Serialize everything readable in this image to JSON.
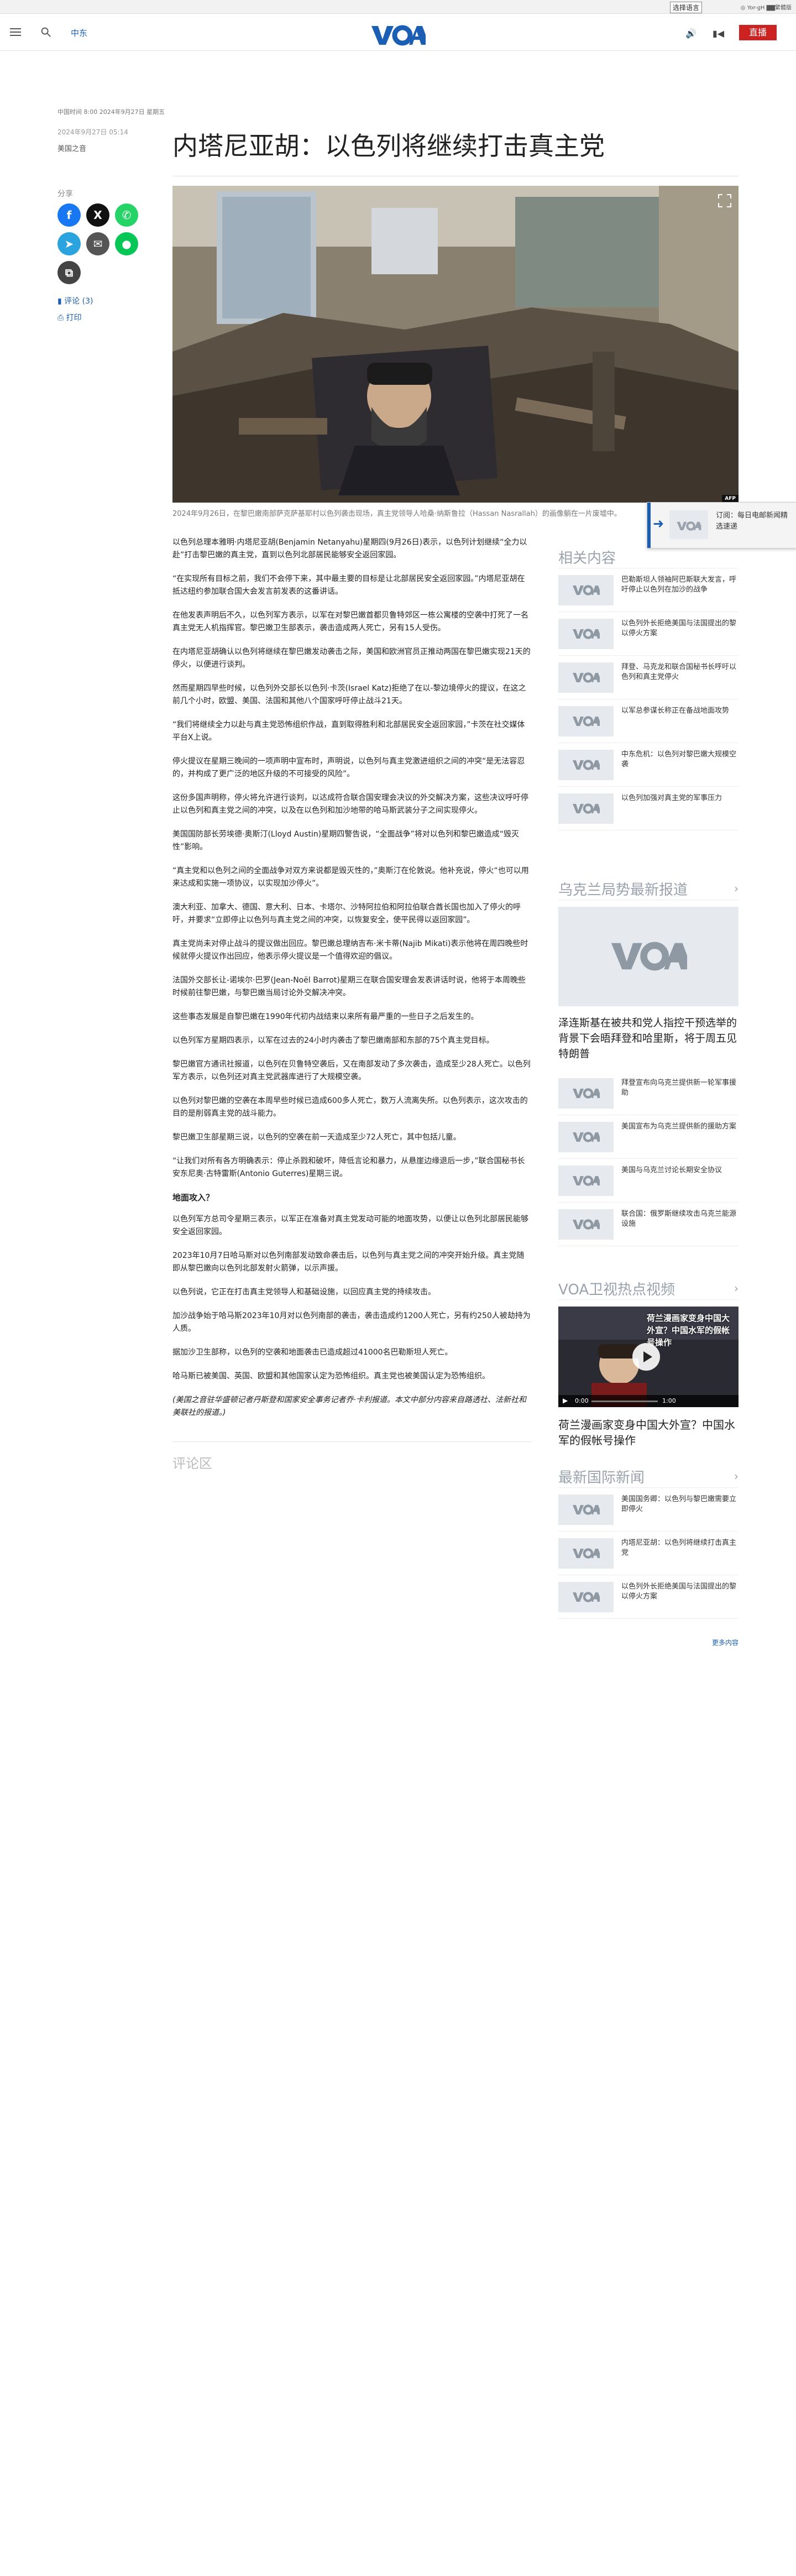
{
  "topbar": {
    "language_select": "选择语言",
    "small_links": "◎ Yor-gH ▇▇繁體版"
  },
  "header": {
    "section": "中东",
    "live_label": "直播",
    "logo_text": "VOA"
  },
  "article": {
    "dateline": "中国时间 8:00 2024年9月27日 星期五",
    "published": "2024年9月27日 05:14",
    "author": "美国之音",
    "title": "内塔尼亚胡：以色列将继续打击真主党",
    "share_label": "分享",
    "comments_link": "评论 (3)",
    "print_link": "打印",
    "photo_caption": "2024年9月26日，在黎巴嫩南部萨克萨基耶村以色列袭击现场，真主党领导人哈桑·纳斯鲁拉（Hassan Nasrallah）的画像躺在一片废墟中。",
    "photo_credit": "AFP",
    "paragraphs": [
      "以色列总理本雅明·内塔尼亚胡(Benjamin Netanyahu)星期四(9月26日)表示，以色列计划继续“全力以赴”打击黎巴嫩的真主党，直到以色列北部居民能够安全返回家园。",
      "“在实现所有目标之前，我们不会停下来，其中最主要的目标是让北部居民安全返回家园。”内塔尼亚胡在抵达纽约参加联合国大会发言前发表的这番讲话。",
      "在他发表声明后不久，以色列军方表示，以军在对黎巴嫩首都贝鲁特郊区一栋公寓楼的空袭中打死了一名真主党无人机指挥官。黎巴嫩卫生部表示，袭击造成两人死亡，另有15人受伤。",
      "在内塔尼亚胡确认以色列将继续在黎巴嫩发动袭击之际，美国和欧洲官员正推动两国在黎巴嫩实现21天的停火，以便进行谈判。",
      "然而星期四早些时候，以色列外交部长以色列·卡茨(Israel Katz)拒绝了在以-黎边境停火的提议，在这之前几个小时，欧盟、美国、法国和其他八个国家呼吁停止战斗21天。",
      "“我们将继续全力以赴与真主党恐怖组织作战，直到取得胜利和北部居民安全返回家园，”卡茨在社交媒体平台X上说。",
      "停火提议在星期三晚间的一项声明中宣布时，声明说，以色列与真主党激进组织之间的冲突“是无法容忍的，并构成了更广泛的地区升级的不可接受的风险”。",
      "这份多国声明称，停火将允许进行谈判，以达成符合联合国安理会决议的外交解决方案，这些决议呼吁停止以色列和真主党之间的冲突，以及在以色列和加沙地带的哈马斯武装分子之间实现停火。",
      "美国国防部长劳埃德·奥斯汀(Lloyd Austin)星期四警告说，“全面战争”将对以色列和黎巴嫩造成“毁灭性”影响。",
      "“真主党和以色列之间的全面战争对双方来说都是毁灭性的，”奥斯汀在伦敦说。他补充说，停火“也可以用来达成和实施一项协议，以实现加沙停火”。",
      "澳大利亚、加拿大、德国、意大利、日本、卡塔尔、沙特阿拉伯和阿拉伯联合酋长国也加入了停火的呼吁，并要求“立即停止以色列与真主党之间的冲突，以恢复安全，使平民得以返回家园”。",
      "真主党尚未对停止战斗的提议做出回应。黎巴嫩总理纳吉布·米卡蒂(Najib Mikati)表示他将在周四晚些时候就停火提议作出回应，他表示停火提议是一个值得欢迎的倡议。",
      "法国外交部长让-诺埃尔·巴罗(Jean-Noël Barrot)星期三在联合国安理会发表讲话时说，他将于本周晚些时候前往黎巴嫩，与黎巴嫩当局讨论外交解决冲突。",
      "这些事态发展是自黎巴嫩在1990年代初内战结束以来所有最严重的一些日子之后发生的。",
      "以色列军方星期四表示，以军在过去的24小时内袭击了黎巴嫩南部和东部的75个真主党目标。",
      "黎巴嫩官方通讯社报道，以色列在贝鲁特空袭后，又在南部发动了多次袭击，造成至少28人死亡。以色列军方表示，以色列还对真主党武器库进行了大规模空袭。",
      "以色列对黎巴嫩的空袭在本周早些时候已造成600多人死亡，数万人流离失所。以色列表示，这次攻击的目的是削弱真主党的战斗能力。",
      "黎巴嫩卫生部星期三说，以色列的空袭在前一天造成至少72人死亡，其中包括儿童。",
      "“让我们对所有各方明确表示：停止杀戮和破坏，降低言论和暴力，从悬崖边缘退后一步，”联合国秘书长安东尼奥·古特雷斯(Antonio Guterres)星期三说。"
    ],
    "subheading": "地面攻入？",
    "paragraphs2": [
      "以色列军方总司令星期三表示，以军正在准备对真主党发动可能的地面攻势，以便让以色列北部居民能够安全返回家园。",
      "2023年10月7日哈马斯对以色列南部发动致命袭击后，以色列与真主党之间的冲突开始升级。真主党随即从黎巴嫩向以色列北部发射火箭弹，以示声援。",
      "以色列说，它正在打击真主党领导人和基础设施，以回应真主党的持续攻击。",
      "加沙战争始于哈马斯2023年10月对以色列南部的袭击，袭击造成约1200人死亡，另有约250人被劫持为人质。",
      "据加沙卫生部称，以色列的空袭和地面袭击已造成超过41000名巴勒斯坦人死亡。",
      "哈马斯已被美国、英国、欧盟和其他国家认定为恐怖组织。真主党也被美国认定为恐怖组织。"
    ],
    "credit": "(美国之音驻华盛顿记者丹斯登和国家安全事务记者乔·卡利报道。本文中部分内容来自路透社、法新社和美联社的报道。)"
  },
  "float_widget": {
    "text": "订阅：每日电邮新闻精选速递"
  },
  "comments": {
    "title": "评论区"
  },
  "sidebar": {
    "related_title": "相关内容",
    "related": [
      "巴勒斯坦人领袖阿巴斯联大发言，呼吁停止以色列在加沙的战争",
      "以色列外长拒绝美国与法国提出的黎以停火方案",
      "拜登、马克龙和联合国秘书长呼吁以色列和真主党停火",
      "以军总参谋长称正在备战地面攻势",
      "中东危机：以色列对黎巴嫩大规模空袭",
      "以色列加强对真主党的军事压力"
    ],
    "ukraine_title": "乌克兰局势最新报道",
    "ukraine_feature": "泽连斯基在被共和党人指控干预选举的背景下会晤拜登和哈里斯，将于周五见特朗普",
    "ukraine_items": [
      "拜登宣布向乌克兰提供新一轮军事援助",
      "美国宣布为乌克兰提供新的援助方案",
      "美国与乌克兰讨论长期安全协议",
      "联合国：俄罗斯继续攻击乌克兰能源设施"
    ],
    "video_title": "VOA卫视热点视频",
    "video_caption": "荷兰漫画家变身中国大外宣？中国水军的假帐号操作",
    "video_overlay": "荷兰漫画家变身中国大外宣？中国水军的假帐号操作",
    "video_time": "0:00",
    "video_duration": "1:00",
    "intl_title": "最新国际新闻",
    "intl_items": [
      "美国国务卿：以色列与黎巴嫩需要立即停火",
      "内塔尼亚胡：以色列将继续打击真主党",
      "以色列外长拒绝美国与法国提出的黎以停火方案"
    ],
    "more_link": "更多内容"
  },
  "colors": {
    "accent": "#1a5fb4",
    "live": "#cc2222",
    "logo": "#1a5fb4"
  },
  "icons": [
    "menu-icon",
    "search-icon",
    "audio-icon",
    "video-icon",
    "facebook-icon",
    "x-icon",
    "whatsapp-icon",
    "telegram-icon",
    "email-icon",
    "line-icon",
    "copy-link-icon",
    "comment-icon",
    "print-icon",
    "fullscreen-icon",
    "play-icon"
  ]
}
